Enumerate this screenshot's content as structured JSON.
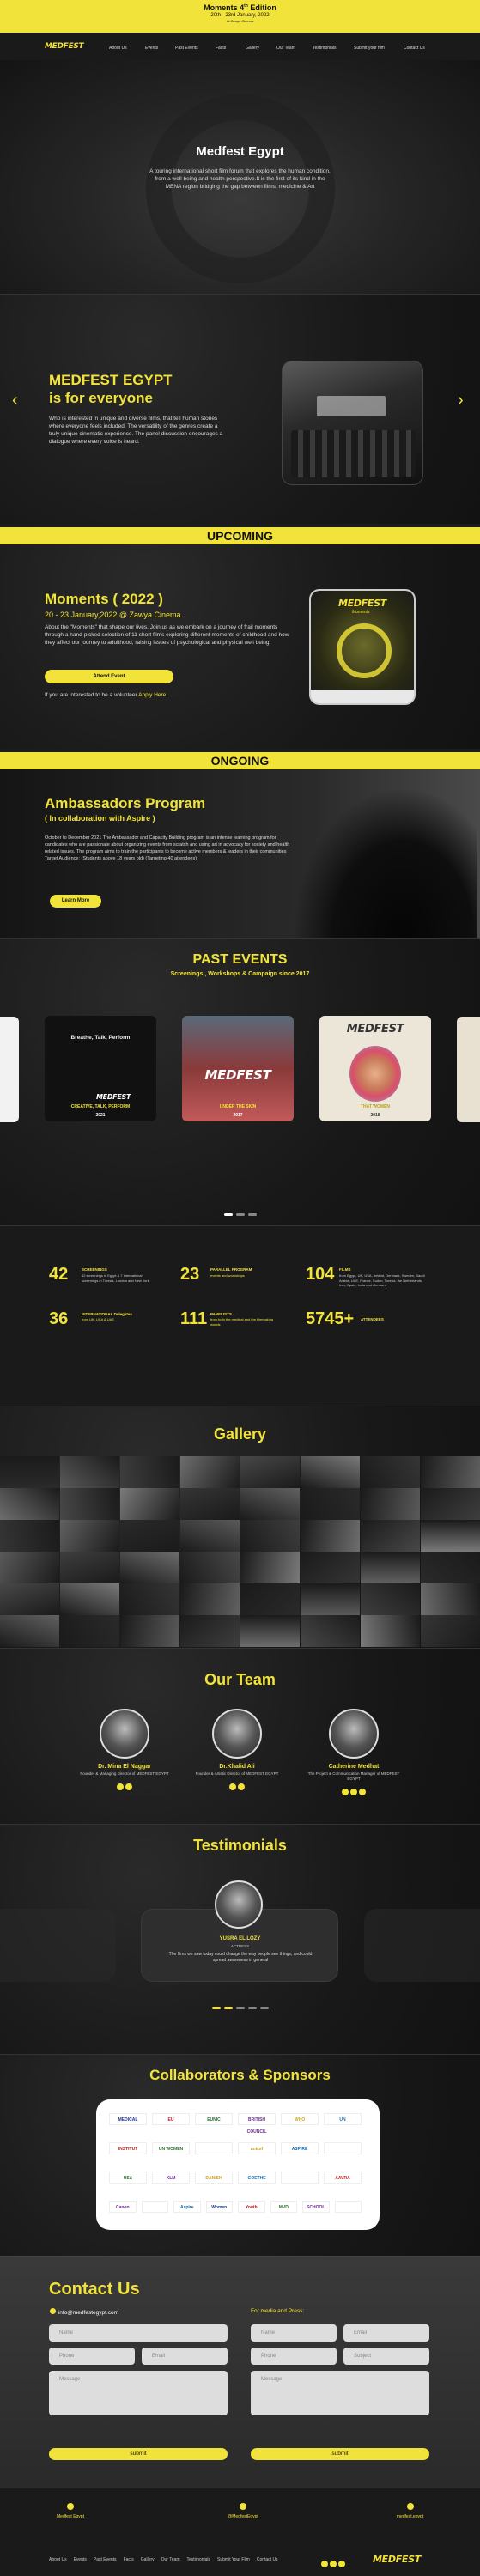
{
  "announcement": {
    "line1": "Moments 4",
    "sup": "th",
    "line1b": " Edition",
    "line2": "20th - 23rd January, 2022",
    "line3": "At Zawya Cinema"
  },
  "nav": {
    "logo": "MEDFEST",
    "items": [
      "About Us",
      "Events",
      "Past Events",
      "Facts",
      "Gallery",
      "Our Team",
      "Testimonials",
      "Submit your film",
      "Contact Us"
    ]
  },
  "hero": {
    "title": "Medfest Egypt",
    "text": "A touring international short film forum that explores the human condition, from a well being and health perspective.It is the first of its kind in the MENA region bridging the gap between films, medicine & Art"
  },
  "slider": {
    "title1": "MEDFEST EGYPT",
    "title2": "is for everyone",
    "text": "Who is interested in unique and diverse films, that tell human stories where everyone feels included. The versatility of the genres create a truly unique cinematic experience. The panel discussion encourages a dialogue where every voice is heard.",
    "prev": "‹",
    "next": "›"
  },
  "upcoming": {
    "bar": "UPCOMING",
    "title": "Moments ( 2022 )",
    "date": "20 - 23 January,2022 @ Zawya Cinema",
    "text": "About the \"Moments\" that shape our lives. Join us as we embark on a journey of frail moments through a hand-picked selection of 11 short films exploring different moments of childhood and how they affect our journey to adulthood, raising issues of psychological and physical well being.",
    "button": "Attend Event",
    "volunteer_prefix": "If you are interested to be a volunteer ",
    "volunteer_link": "Apply Here.",
    "poster_logo": "MEDFEST",
    "poster_sub": "Moments"
  },
  "ongoing": {
    "bar": "ONGOING",
    "title": "Ambassadors Program",
    "subtitle": "( In collaboration with Aspire )",
    "text": "October to December 2021 The Ambassador and Capacity Building program is an intense learning program for candidates who are passionate about organizing events from scratch and using art in advocacy for society and health related issues. The program aims to train the participants to become active members & leaders in their communities Target Audience: (Students above 18 years old) (Targeting 40 attendees)",
    "button": "Learn More"
  },
  "past": {
    "title": "PAST EVENTS",
    "subtitle": "Screenings , Workshops & Campaign since 2017",
    "cards": [
      {
        "label": "CREATIVE, TALK, PERFORM",
        "year": "2021",
        "header": "Breathe, Talk, Perform"
      },
      {
        "label": "UNDER THE SKIN",
        "year": "2017",
        "header": "MEDFEST"
      },
      {
        "label": "THAT WOMEN",
        "year": "2018",
        "header": "MEDFEST"
      }
    ]
  },
  "facts": [
    {
      "num": "42",
      "label": "SCREENINGS",
      "text": "42 screenings in Egypt & 7 international screenings in Tunisia, London and New York"
    },
    {
      "num": "23",
      "label": "PARALLEL PROGRAM",
      "text": "events and workshops"
    },
    {
      "num": "104",
      "label": "FILMS",
      "text": "from Egypt, UK, USA, Ireland, Denmark, Sweden, Saudi Arabia, UAE, France, Sudan, Tunisia, the Netherlands, Iran, Spain, India and Germany"
    },
    {
      "num": "36",
      "label": "INTERNATIONAL Delegates",
      "text": "from UK, USA & UAE"
    },
    {
      "num": "111",
      "label": "PANELISTS",
      "text": "from both the medical and the filmmaking worlds"
    },
    {
      "num": "5745+",
      "label": "ATTENDEES",
      "text": ""
    }
  ],
  "gallery": {
    "title": "Gallery"
  },
  "team": {
    "title": "Our Team",
    "members": [
      {
        "name": "Dr. Mina El Naggar",
        "role": "Founder & Managing Director of MEDFEST EGYPT"
      },
      {
        "name": "Dr.Khalid Ali",
        "role": "Founder & Artistic Director of MEDFEST EGYPT"
      },
      {
        "name": "Catherine Medhat",
        "role": "The Project & Communication Manager of MEDFEST EGYPT"
      }
    ]
  },
  "testimonials": {
    "title": "Testimonials",
    "name": "YUSRA EL LOZY",
    "role": "ACTRESS",
    "quote": "The films we saw today could change the way people see things, and could spread awareness in general"
  },
  "sponsors": {
    "title": "Collaborators & Sponsors",
    "row1": [
      "MEDICAL",
      "EU",
      "EUNIC",
      "BRITISH COUNCIL",
      "WHO",
      "UN"
    ],
    "row2": [
      "INSTITUT",
      "UN WOMEN",
      "",
      "unicef",
      "ASPIRE",
      ""
    ],
    "row3": [
      "USA",
      "KLM",
      "DANISH",
      "GOETHE",
      "",
      "AAVRA"
    ],
    "row4": [
      "Canon",
      "",
      "Aspire",
      "Women",
      "Youth",
      "MVD",
      "SCHOOL",
      ""
    ]
  },
  "contact": {
    "title": "Contact Us",
    "email": "info@medfestegypt.com",
    "partner_title": "For media and Press:",
    "name": "Name",
    "email_ph": "Email",
    "phone": "Phone",
    "subject": "Subject",
    "message": "Message",
    "submit": "submit"
  },
  "footer": {
    "col1": "Medfest Egypt",
    "col2": "@MedfestEgypt",
    "col3": "medfest.egypt",
    "links": [
      "About Us",
      "Events",
      "Past Events",
      "Facts",
      "Gallery",
      "Our Team",
      "Testimonials",
      "Submit Your Film",
      "Contact Us"
    ],
    "logo": "MEDFEST"
  },
  "colors": {
    "accent": "#f2e33a",
    "background": "#1c1c1c"
  }
}
